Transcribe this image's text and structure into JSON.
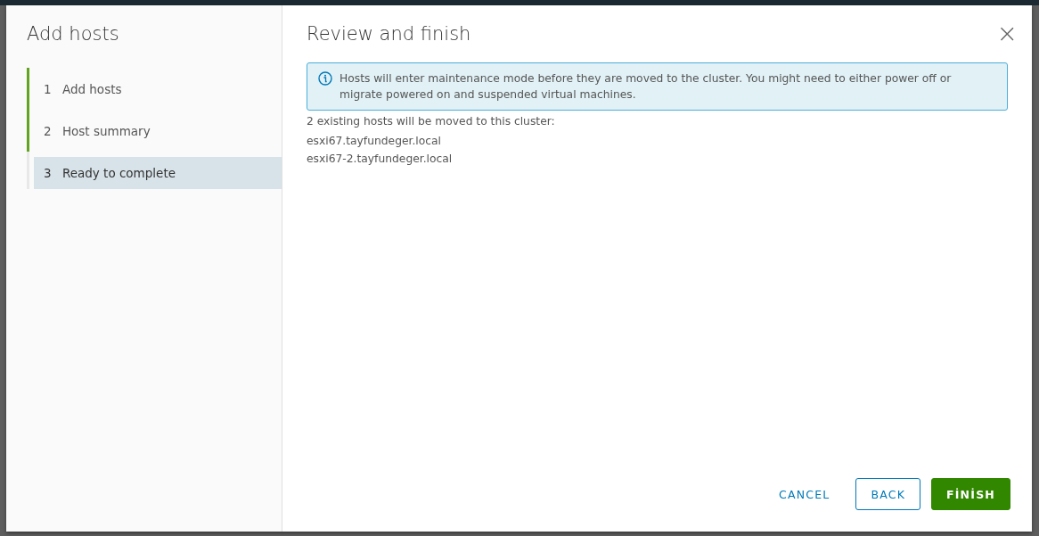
{
  "dialog": {
    "title": "Add hosts",
    "close_label": "×"
  },
  "steps": [
    {
      "number": "1",
      "label": "Add hosts",
      "completed": true,
      "selected": false
    },
    {
      "number": "2",
      "label": "Host summary",
      "completed": true,
      "selected": false
    },
    {
      "number": "3",
      "label": "Ready to complete",
      "completed": false,
      "selected": true
    }
  ],
  "page": {
    "title": "Review and finish",
    "alert": {
      "kind": "info",
      "text": "Hosts will enter maintenance mode before they are moved to the cluster. You might need to either power off or migrate powered on and suspended virtual machines."
    },
    "summary": "2 existing hosts will be moved to this cluster:",
    "hosts": [
      "esxi67.tayfundeger.local",
      "esxi67-2.tayfundeger.local"
    ]
  },
  "buttons": [
    {
      "label": "CANCEL",
      "kind": "flat"
    },
    {
      "label": "BACK",
      "kind": "outline"
    },
    {
      "label": "FİNİSH",
      "kind": "primary"
    }
  ]
}
